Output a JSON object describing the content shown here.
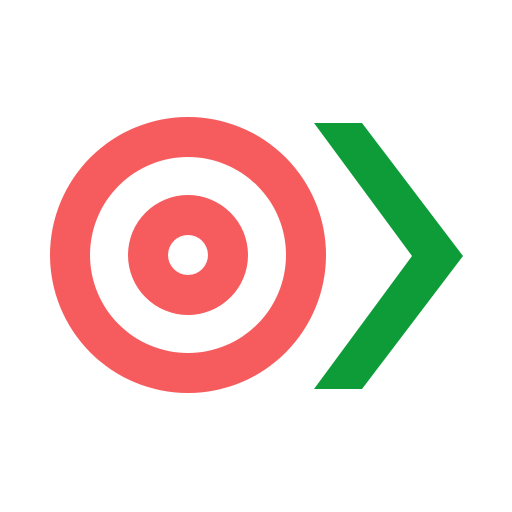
{
  "logo": {
    "icons": {
      "target": "target-icon",
      "chevron": "chevron-right-icon"
    },
    "colors": {
      "target": "#f65b5d",
      "chevron": "#0e9c39",
      "background": "#ffffff"
    }
  }
}
